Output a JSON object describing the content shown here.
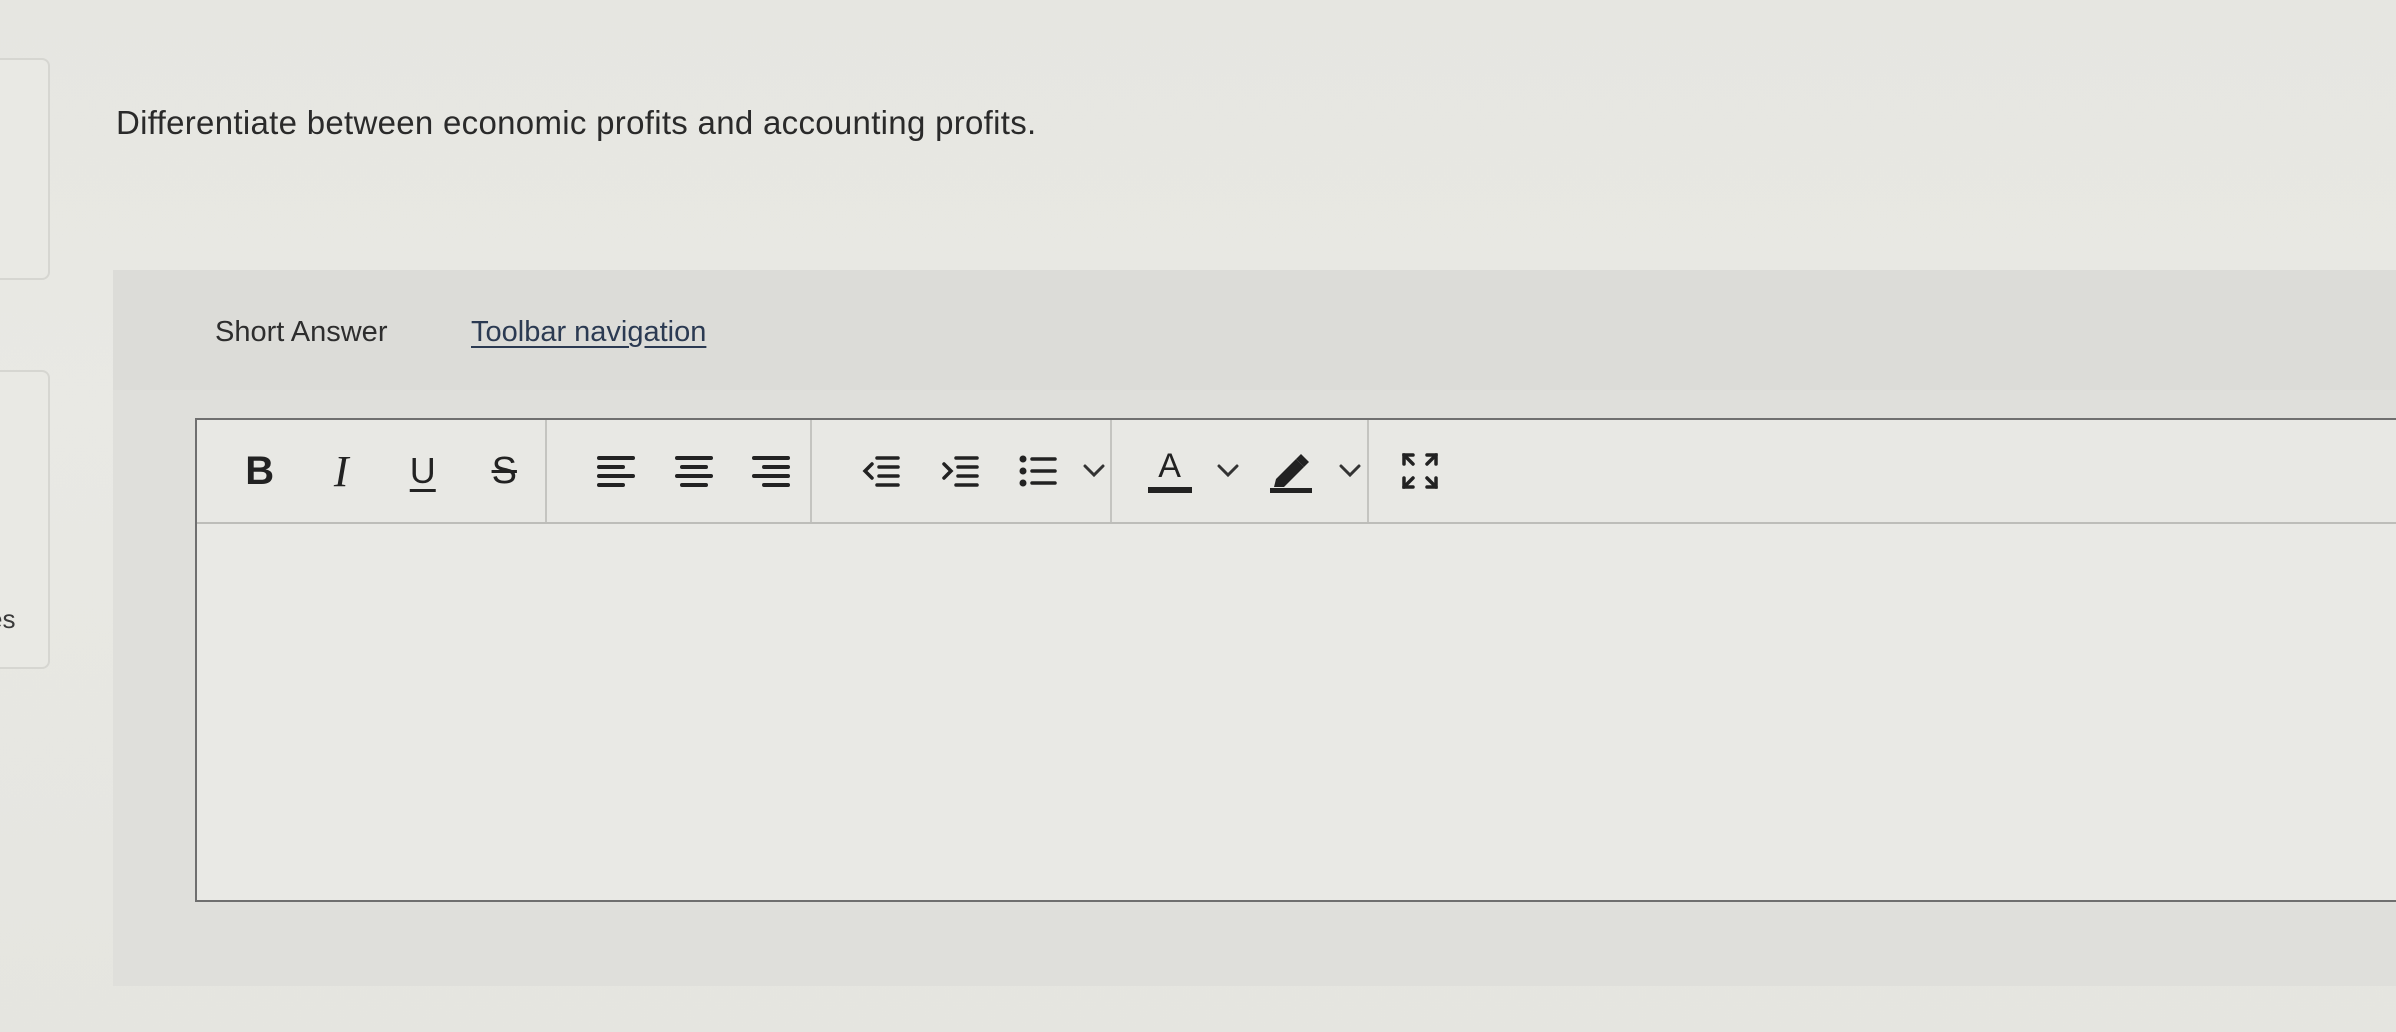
{
  "question": {
    "text": "Differentiate between economic profits and accounting profits."
  },
  "left_rail": {
    "partial_text": "es"
  },
  "answer": {
    "type_label": "Short Answer",
    "toolbar_nav_label": "Toolbar navigation"
  },
  "toolbar": {
    "bold": "B",
    "italic": "I",
    "underline": "U",
    "strikethrough": "S",
    "text_color_letter": "A",
    "icons": [
      "bold-icon",
      "italic-icon",
      "underline-icon",
      "strikethrough-icon",
      "align-left-icon",
      "align-center-icon",
      "align-right-icon",
      "outdent-icon",
      "indent-icon",
      "bullet-list-icon",
      "chevron-down-icon",
      "text-color-icon",
      "chevron-down-icon",
      "highlight-icon",
      "chevron-down-icon",
      "fullscreen-icon"
    ]
  },
  "editor": {
    "value": ""
  },
  "colors": {
    "background": "#e7e7e2",
    "panel": "#dfdfdb",
    "editor_border": "#6f6f6f",
    "link": "#2b3a52"
  }
}
